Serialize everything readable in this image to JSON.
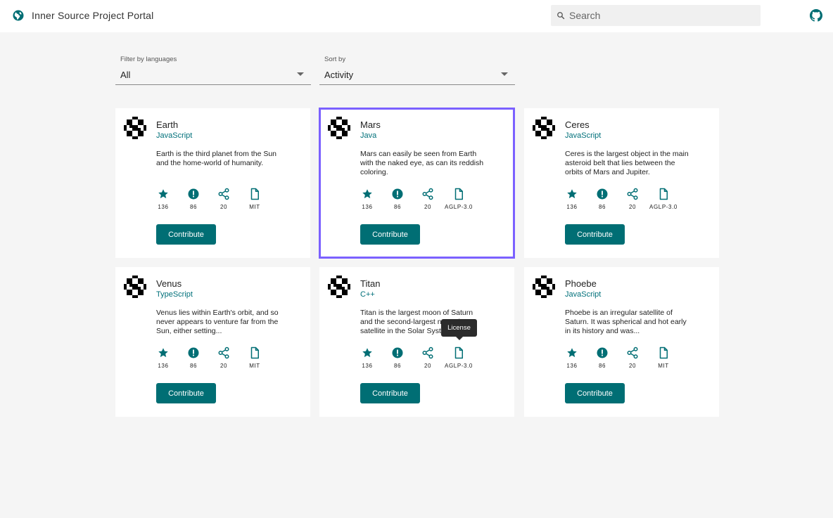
{
  "header": {
    "title": "Inner Source Project Portal",
    "search_placeholder": "Search"
  },
  "filters": {
    "language_label": "Filter by languages",
    "language_value": "All",
    "sort_label": "Sort by",
    "sort_value": "Activity"
  },
  "colors": {
    "accent": "#006e74",
    "selection": "#7b61ff"
  },
  "cards": [
    {
      "title": "Earth",
      "language": "JavaScript",
      "description": "Earth is the third planet from the Sun and the home-world of humanity.",
      "stars": "136",
      "issues": "86",
      "forks": "20",
      "license": "MIT",
      "button": "Contribute"
    },
    {
      "title": "Mars",
      "language": "Java",
      "description": "Mars can easily be seen from Earth with the naked eye, as can its reddish coloring.",
      "stars": "136",
      "issues": "86",
      "forks": "20",
      "license": "AGLP-3.0",
      "button": "Contribute"
    },
    {
      "title": "Ceres",
      "language": "JavaScript",
      "description": "Ceres is the largest object in the main asteroid belt that lies between the orbits of Mars and Jupiter.",
      "stars": "136",
      "issues": "86",
      "forks": "20",
      "license": "AGLP-3.0",
      "button": "Contribute"
    },
    {
      "title": "Venus",
      "language": "TypeScript",
      "description": "Venus lies within Earth's orbit, and so never appears to venture far from the Sun, either setting...",
      "stars": "136",
      "issues": "86",
      "forks": "20",
      "license": "MIT",
      "button": "Contribute"
    },
    {
      "title": "Titan",
      "language": "C++",
      "description": "Titan is the largest moon of Saturn and the second-largest natural satellite in the Solar System.",
      "stars": "136",
      "issues": "86",
      "forks": "20",
      "license": "AGLP-3.0",
      "button": "Contribute"
    },
    {
      "title": "Phoebe",
      "language": "JavaScript",
      "description": "Phoebe is an irregular satellite of Saturn. It was spherical and hot early in its history and was...",
      "stars": "136",
      "issues": "86",
      "forks": "20",
      "license": "MIT",
      "button": "Contribute"
    }
  ],
  "tooltip": "License"
}
